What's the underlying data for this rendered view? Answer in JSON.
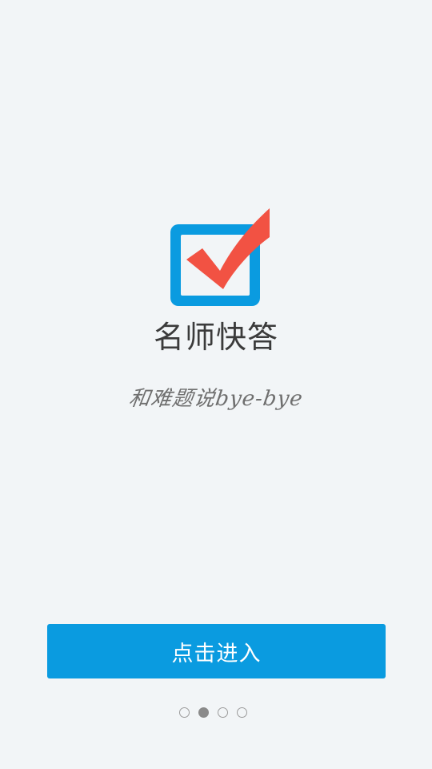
{
  "app": {
    "name": "名师快答",
    "slogan": "和难题说bye-bye",
    "logo_icon": "checkbox-checked-icon",
    "colors": {
      "background": "#f2f5f7",
      "primary_blue": "#0a9be0",
      "check_red": "#f25243",
      "text_dark": "#3b3b3b",
      "text_slogan": "#6f6f6f"
    }
  },
  "actions": {
    "enter_label": "点击进入"
  },
  "pager": {
    "count": 4,
    "active_index": 1
  }
}
